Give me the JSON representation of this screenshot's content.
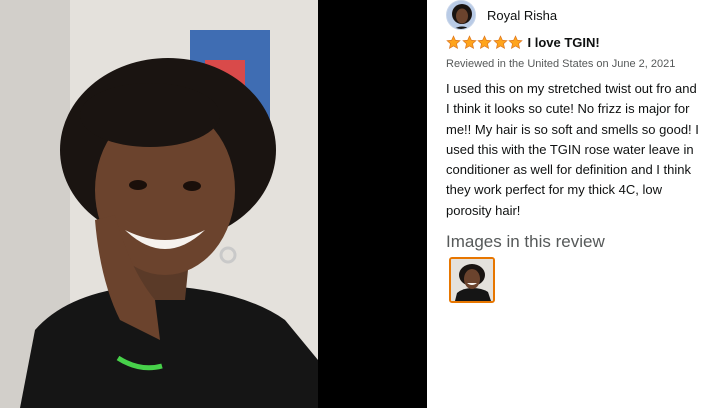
{
  "reviewer": {
    "name": "Royal Risha"
  },
  "review": {
    "rating": 5,
    "rating_max": 5,
    "title": "I love TGIN!",
    "meta": "Reviewed in the United States on June 2, 2021",
    "lines": [
      "I used this on my stretched twist out fro and",
      "I think it looks so cute! No frizz is major for",
      "me!! My hair is so soft and smells so good! I",
      "used this with the TGIN rose water leave in",
      "conditioner as well for definition and I think",
      "they work perfect for my thick 4C, low",
      "porosity hair!"
    ]
  },
  "images_section": {
    "heading": "Images in this review"
  },
  "colors": {
    "star": "#ffa41c",
    "star_outline": "#de7921",
    "thumb_border": "#e77600",
    "meta_text": "#565959"
  }
}
